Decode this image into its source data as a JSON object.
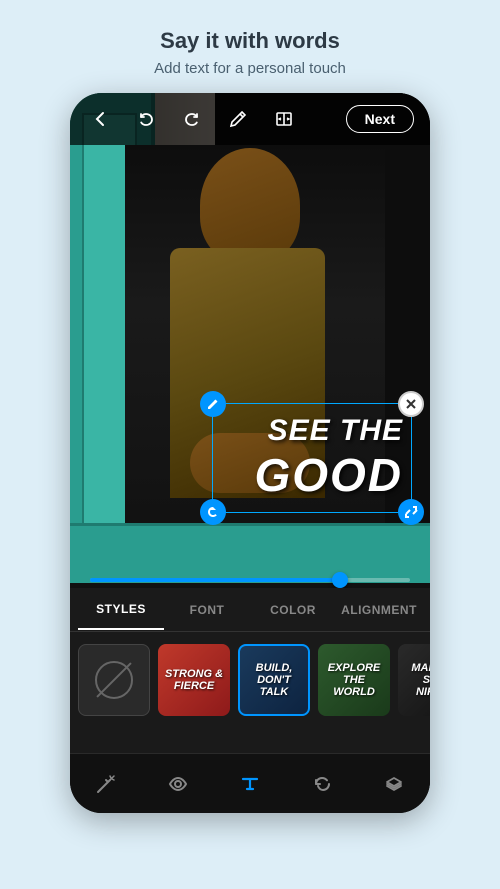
{
  "header": {
    "title": "Say it with words",
    "subtitle": "Add text for a personal touch"
  },
  "toolbar": {
    "next_label": "Next",
    "icons": {
      "back": "←",
      "undo": "↺",
      "redo": "↻",
      "pen": "✎",
      "compare": "⊡"
    }
  },
  "text_overlay": {
    "line1": "SEE THE",
    "line2": "GOOD"
  },
  "tabs": {
    "items": [
      {
        "id": "styles",
        "label": "STYLES",
        "active": true
      },
      {
        "id": "font",
        "label": "FONT",
        "active": false
      },
      {
        "id": "color",
        "label": "COLOR",
        "active": false
      },
      {
        "id": "alignment",
        "label": "ALIGNMENT",
        "active": false
      }
    ]
  },
  "style_cards": [
    {
      "id": "none",
      "label": ""
    },
    {
      "id": "strong-fierce",
      "label": "STRONG & FIERCE",
      "bg": "red"
    },
    {
      "id": "build-dont-talk",
      "label": "BUILD, DON'T TALK",
      "bg": "blue",
      "selected": true
    },
    {
      "id": "explore-the-world",
      "label": "EXPLORE THE WORLD",
      "bg": "green"
    },
    {
      "id": "make-it-significant",
      "label": "MAKE IT SIGNIFICANT",
      "bg": "dark"
    }
  ],
  "bottom_toolbar": {
    "icons": [
      "wand",
      "eye",
      "text",
      "history",
      "layers"
    ]
  }
}
